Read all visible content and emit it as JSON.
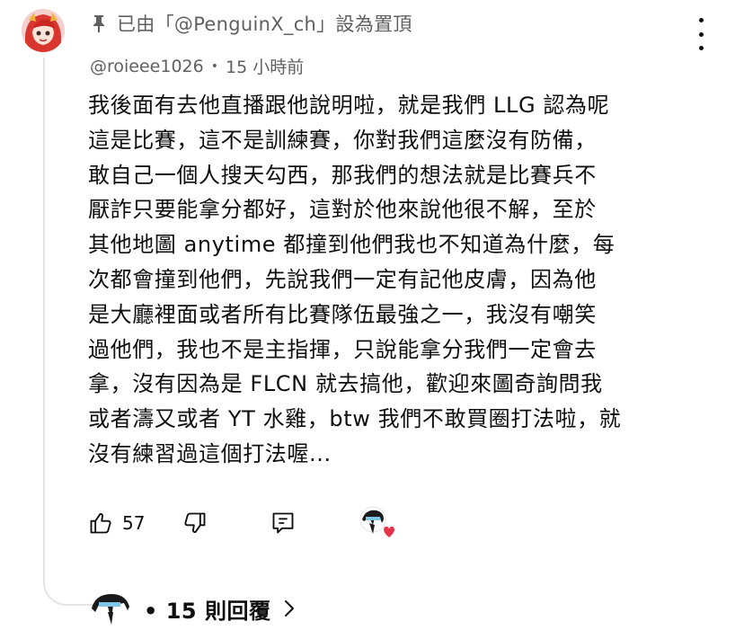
{
  "pinned": {
    "text": "已由「@PenguinX_ch」設為置頂"
  },
  "comment": {
    "author": "@roieee1026",
    "separator": "•",
    "timestamp": "15 小時前",
    "lines": [
      "我後面有去他直播跟他說明啦，就是我們 LLG 認為呢",
      "這是比賽，這不是訓練賽，你對我們這麼沒有防備，",
      "敢自己一個人搜天勾西，那我們的想法就是比賽兵不",
      "厭詐只要能拿分都好，這對於他來說他很不解，至於",
      "其他地圖 anytime 都撞到他們我也不知道為什麼，每",
      "次都會撞到他們，先說我們一定有記他皮膚，因為他",
      "是大廳裡面或者所有比賽隊伍最強之一，我沒有嘲笑",
      "過他們，我也不是主指揮，只說能拿分我們一定會去",
      "拿，沒有因為是 FLCN 就去搞他，歡迎來圖奇詢問我",
      "或者濤又或者 YT 水雞，btw 我們不敢買圈打法啦，就",
      "沒有練習過這個打法喔..."
    ]
  },
  "actions": {
    "like_count": "57"
  },
  "replies": {
    "label": "• 15 則回覆"
  },
  "icons": {
    "pin": "pin-icon",
    "more": "more-vert-icon",
    "like": "thumb-up-icon",
    "dislike": "thumb-down-icon",
    "reply": "reply-icon",
    "heart": "creator-heart-icon",
    "chevron": "chevron-right-icon"
  },
  "colors": {
    "heart": "#e8344a",
    "secondary_text": "#606060"
  }
}
